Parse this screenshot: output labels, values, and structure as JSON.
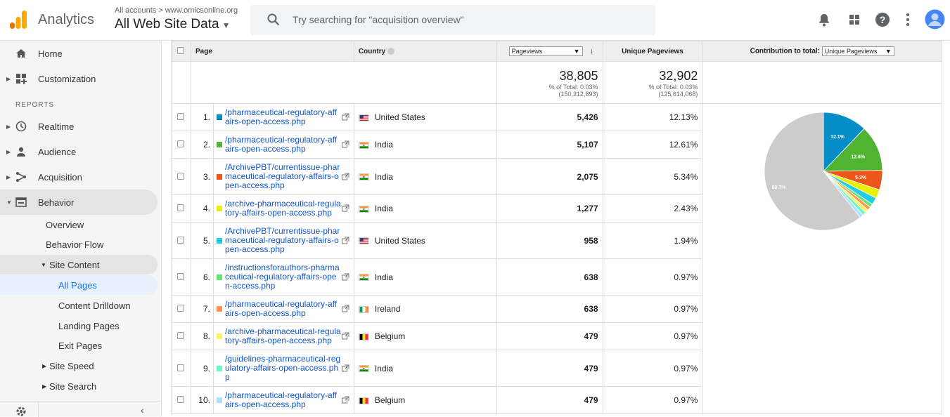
{
  "app": {
    "title": "Analytics",
    "crumb": "All accounts > www.omicsonline.org",
    "property": "All Web Site Data"
  },
  "search": {
    "placeholder": "Try searching for \"acquisition overview\""
  },
  "sidebar": {
    "reports_label": "REPORTS",
    "items": [
      {
        "label": "Home"
      },
      {
        "label": "Customization"
      },
      {
        "label": "Realtime"
      },
      {
        "label": "Audience"
      },
      {
        "label": "Acquisition"
      },
      {
        "label": "Behavior"
      }
    ],
    "behavior_sub": [
      "Overview",
      "Behavior Flow",
      "Site Content",
      "All Pages",
      "Content Drilldown",
      "Landing Pages",
      "Exit Pages",
      "Site Speed",
      "Site Search"
    ]
  },
  "table": {
    "headers": {
      "page": "Page",
      "country": "Country",
      "pageviews_select": "Pageviews",
      "unique": "Unique Pageviews",
      "contribution": "Contribution to total:",
      "contribution_select": "Unique Pageviews"
    },
    "totals": {
      "pageviews": "38,805",
      "pageviews_pct": "% of Total: 0.03%",
      "pageviews_of": "(150,312,893)",
      "unique": "32,902",
      "unique_pct": "% of Total: 0.03%",
      "unique_of": "(125,614,068)"
    },
    "rows": [
      {
        "idx": "1.",
        "page": "/pharmaceutical-regulatory-affairs-open-access.php",
        "country": "United States",
        "flag": "us",
        "pageviews": "5,426",
        "unique": "12.13%",
        "color": "#058dc7"
      },
      {
        "idx": "2.",
        "page": "/pharmaceutical-regulatory-affairs-open-access.php",
        "country": "India",
        "flag": "in",
        "pageviews": "5,107",
        "unique": "12.61%",
        "color": "#50b432"
      },
      {
        "idx": "3.",
        "page": "/ArchivePBT/currentissue-pharmaceutical-regulatory-affairs-open-access.php",
        "country": "India",
        "flag": "in",
        "pageviews": "2,075",
        "unique": "5.34%",
        "color": "#ed561b"
      },
      {
        "idx": "4.",
        "page": "/archive-pharmaceutical-regulatory-affairs-open-access.php",
        "country": "India",
        "flag": "in",
        "pageviews": "1,277",
        "unique": "2.43%",
        "color": "#edef00"
      },
      {
        "idx": "5.",
        "page": "/ArchivePBT/currentissue-pharmaceutical-regulatory-affairs-open-access.php",
        "country": "United States",
        "flag": "us",
        "pageviews": "958",
        "unique": "1.94%",
        "color": "#24cbe5"
      },
      {
        "idx": "6.",
        "page": "/instructionsforauthors-pharmaceutical-regulatory-affairs-open-access.php",
        "country": "India",
        "flag": "in",
        "pageviews": "638",
        "unique": "0.97%",
        "color": "#64e572"
      },
      {
        "idx": "7.",
        "page": "/pharmaceutical-regulatory-affairs-open-access.php",
        "country": "Ireland",
        "flag": "ie",
        "pageviews": "638",
        "unique": "0.97%",
        "color": "#ff9655"
      },
      {
        "idx": "8.",
        "page": "/archive-pharmaceutical-regulatory-affairs-open-access.php",
        "country": "Belgium",
        "flag": "be",
        "pageviews": "479",
        "unique": "0.97%",
        "color": "#fff263"
      },
      {
        "idx": "9.",
        "page": "/guidelines-pharmaceutical-regulatory-affairs-open-access.php",
        "country": "India",
        "flag": "in",
        "pageviews": "479",
        "unique": "0.97%",
        "color": "#6af9c4"
      },
      {
        "idx": "10.",
        "page": "/pharmaceutical-regulatory-affairs-open-access.php",
        "country": "Belgium",
        "flag": "be",
        "pageviews": "479",
        "unique": "0.97%",
        "color": "#b2deff"
      }
    ]
  },
  "pie": {
    "values": [
      12.13,
      12.61,
      5.34,
      2.43,
      1.94,
      0.97,
      0.97,
      0.97,
      0.97,
      0.97,
      60.7
    ],
    "colors": [
      "#058dc7",
      "#50b432",
      "#ed561b",
      "#edef00",
      "#24cbe5",
      "#64e572",
      "#ff9655",
      "#fff263",
      "#6af9c4",
      "#b2deff",
      "#cccccc"
    ],
    "labels": [
      "12.1%",
      "12.6%",
      "5.3%",
      "",
      "",
      "",
      "",
      "",
      "",
      "",
      "60.7%"
    ]
  }
}
